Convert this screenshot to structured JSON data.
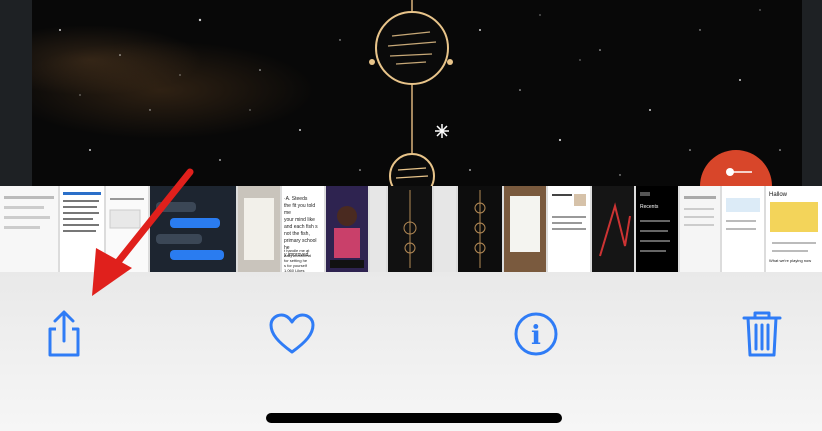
{
  "colors": {
    "accent": "#2f7cf6",
    "annotation_arrow": "#e0201c",
    "photo_background": "#080808",
    "toolbar_background": "#f2f2f2"
  },
  "toolbar": {
    "buttons": [
      {
        "icon": "share-icon"
      },
      {
        "icon": "heart-icon"
      },
      {
        "icon": "info-icon"
      },
      {
        "icon": "trash-icon"
      }
    ],
    "info_glyph": "i"
  },
  "thumbnails": {
    "items": [
      {
        "tone": "light"
      },
      {
        "tone": "light"
      },
      {
        "tone": "light"
      },
      {
        "tone": "light"
      },
      {
        "tone": "dark"
      },
      {
        "tone": "light"
      },
      {
        "tone": "light"
      },
      {
        "tone": "light"
      },
      {
        "tone": "dark"
      },
      {
        "tone": "dark"
      },
      {
        "tone": "dark"
      },
      {
        "tone": "light"
      },
      {
        "tone": "light"
      },
      {
        "tone": "light"
      },
      {
        "tone": "dark"
      },
      {
        "tone": "light"
      },
      {
        "tone": "dark"
      },
      {
        "tone": "light"
      },
      {
        "tone": "light"
      },
      {
        "tone": "light"
      }
    ],
    "texts": [
      "·A. Steeds",
      "the fit you told me",
      "your mind like",
      "and each fish s",
      "not the fish,",
      "primary school he",
      "y improved.",
      "t handle me at",
      "eally commend",
      "for setting he",
      "s for yourself",
      "1,060 Likes",
      "Hallow",
      "Recents",
      "What we're playing now"
    ]
  },
  "annotation": {
    "type": "red-arrow"
  }
}
